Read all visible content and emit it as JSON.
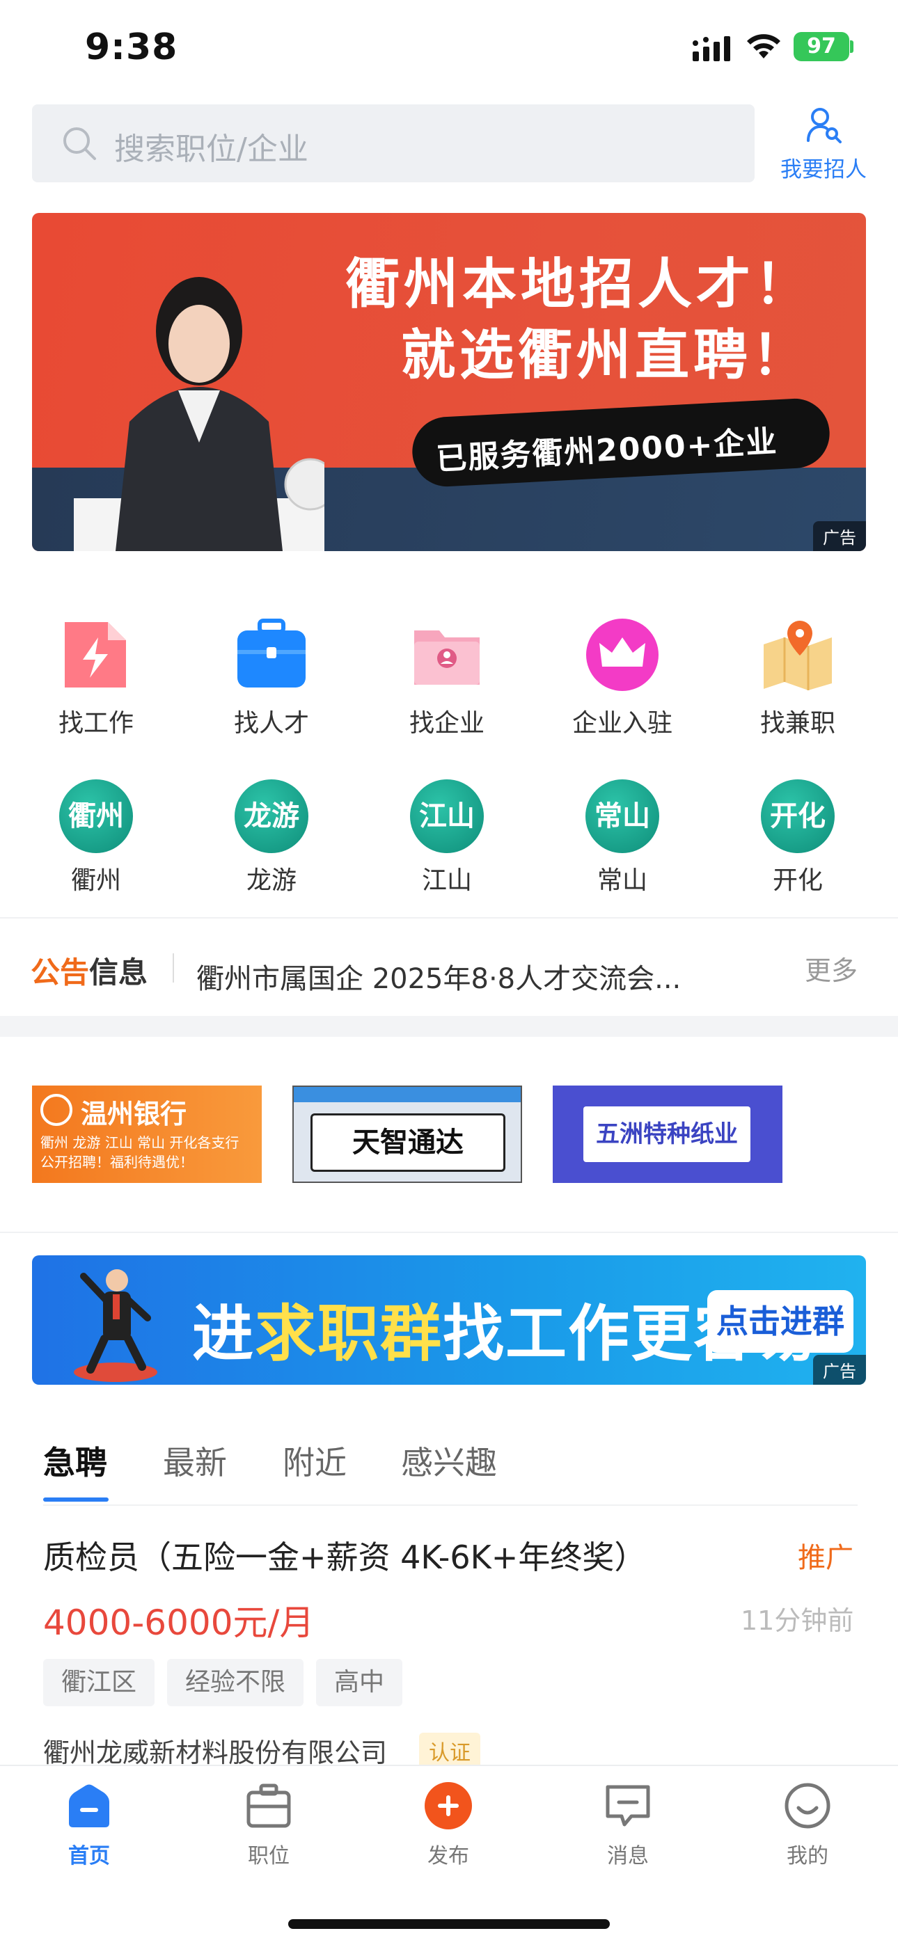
{
  "status": {
    "time": "9:38",
    "battery": "97"
  },
  "search": {
    "placeholder": "搜索职位/企业",
    "recruit_label": "我要招人"
  },
  "banner": {
    "line1": "衢州本地招人才！",
    "line2": "就选衢州直聘！",
    "pill": "已服务衢州2000+企业",
    "ad": "广告"
  },
  "quick_menu": [
    {
      "label": "找工作",
      "icon": "find-job-icon"
    },
    {
      "label": "找人才",
      "icon": "briefcase-icon"
    },
    {
      "label": "找企业",
      "icon": "folder-person-icon"
    },
    {
      "label": "企业入驻",
      "icon": "crown-icon"
    },
    {
      "label": "找兼职",
      "icon": "map-pin-icon"
    }
  ],
  "cities": [
    {
      "badge": "衢州",
      "label": "衢州"
    },
    {
      "badge": "龙游",
      "label": "龙游"
    },
    {
      "badge": "江山",
      "label": "江山"
    },
    {
      "badge": "常山",
      "label": "常山"
    },
    {
      "badge": "开化",
      "label": "开化"
    }
  ],
  "notice": {
    "tag_a": "公告",
    "tag_b": "信息",
    "text": "衢州市属国企 2025年8·8人才交流会...",
    "more": "更多"
  },
  "logos": {
    "logo1_title": "温州银行",
    "logo1_sub": "衢州 龙游 江山 常山 开化各支行 公开招聘！福利待遇优！",
    "logo2_title": "天智通达",
    "logo3_title": "五洲特种纸业"
  },
  "group_banner": {
    "pre": "进",
    "highlight": "求职群",
    "post": "找工作更容易",
    "button": "点击进群",
    "ad": "广告"
  },
  "tabs": [
    "急聘",
    "最新",
    "附近",
    "感兴趣"
  ],
  "job": {
    "title": "质检员（五险一金+薪资 4K-6K+年终奖）",
    "promo": "推广",
    "salary": "4000-6000元/月",
    "time": "11分钟前",
    "tags": [
      "衢江区",
      "经验不限",
      "高中"
    ],
    "company": "衢州龙威新材料股份有限公司",
    "cert": "认证"
  },
  "nav": [
    {
      "label": "首页",
      "icon": "home-icon"
    },
    {
      "label": "职位",
      "icon": "briefcase-icon"
    },
    {
      "label": "发布",
      "icon": "plus-icon"
    },
    {
      "label": "消息",
      "icon": "message-icon"
    },
    {
      "label": "我的",
      "icon": "smile-icon"
    }
  ],
  "colors": {
    "accent": "#2a7ef5",
    "orange": "#f06a1a",
    "salary": "#e8483c",
    "teal": "#14a58f"
  }
}
